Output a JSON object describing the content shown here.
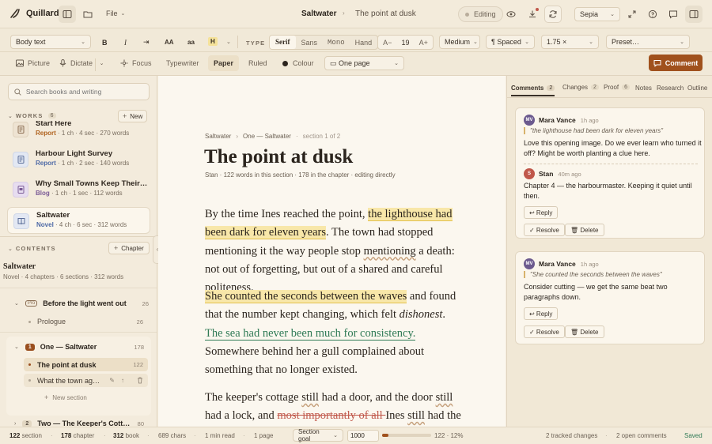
{
  "app": {
    "name": "Quillard",
    "file_menu": "File",
    "doc_title": "Saltwater",
    "section_title": "The point at dusk",
    "mode": "Editing",
    "theme": "Sepia"
  },
  "toolbar": {
    "style": "Body text",
    "bold": "B",
    "italic": "I",
    "indent": "⇥",
    "caps": "AA",
    "lower": "aa",
    "highlight": "H",
    "type_label": "TYPE",
    "fonts": [
      "Serif",
      "Sans",
      "Mono",
      "Hand"
    ],
    "size_dec": "A−",
    "size": "19",
    "size_inc": "A+",
    "weight": "Medium",
    "spacing": "¶ Spaced",
    "line_height": "1.75 ×",
    "preset": "Preset…"
  },
  "toolbar2": {
    "picture": "Picture",
    "dictate": "Dictate",
    "focus": "Focus",
    "typewriter": "Typewriter",
    "paper": "Paper",
    "ruled": "Ruled",
    "colour": "Colour",
    "view": "▭ One page",
    "comment": "Comment"
  },
  "sidebar": {
    "search_placeholder": "Search books and writing",
    "works_label": "WORKS",
    "works_count": "6",
    "new_label": "New",
    "works": [
      {
        "title": "Start Here",
        "kind": "Report",
        "meta": " · 1 ch · 4 sec · 270 words"
      },
      {
        "title": "Harbour Light Survey",
        "kind": "Report",
        "meta": " · 1 ch · 2 sec · 140 words"
      },
      {
        "title": "Why Small Towns Keep Their…",
        "kind": "Blog",
        "meta": " · 1 ch · 1 sec · 112 words"
      },
      {
        "title": "Saltwater",
        "kind": "Novel",
        "meta": " · 4 ch · 6 sec · 312 words"
      }
    ],
    "contents_label": "CONTENTS",
    "chapter_btn": "Chapter",
    "book_title": "Saltwater",
    "book_meta": "Novel · 4 chapters · 6 sections · 312 words",
    "chapters": [
      {
        "badge": "Pro",
        "title": "Before the light went out",
        "count": "26"
      },
      {
        "badge": "1",
        "title": "One — Saltwater",
        "count": "178"
      },
      {
        "badge": "2",
        "title": "Two — The Keeper's Cott…",
        "count": "80"
      }
    ],
    "sections": [
      {
        "title": "Prologue",
        "count": "26"
      },
      {
        "title": "The point at dusk",
        "count": "122"
      },
      {
        "title": "What the town ag…",
        "count": ""
      }
    ],
    "new_section": "New section"
  },
  "doc": {
    "crumb1": "Saltwater",
    "crumb2": "One — Saltwater",
    "crumb3": "section 1 of 2",
    "heading": "The point at dusk",
    "meta": "Stan · 122 words in this section · 178 in the chapter · editing directly",
    "p1a": "By the time Ines reached the point, ",
    "p1hl": "the lighthouse had been dark for eleven years",
    "p1b": ". The town had stopped mentioning it the way people stop ",
    "p1sq": "mentioning",
    "p1c": " a death: not out of forgetting, but out of a shared and careful politeness.",
    "p2hl": "She counted the seconds between the waves",
    "p2a": " and found that the number kept changing, which felt ",
    "p2em": "dishonest",
    "p2b": ". ",
    "p2ins": "The sea had never been much for consistency.",
    "p2c": " Somewhere behind her a gull complained about something that no longer existed.",
    "p3a": "The keeper's cottage ",
    "p3sq1": "still",
    "p3b": " had a door, and the door ",
    "p3sq2": "still",
    "p3c": " had a lock, and ",
    "p3del": "most importantly of all ",
    "p3d": "Ines ",
    "p3sq3": "still",
    "p3e": " had the key"
  },
  "panel": {
    "tabs": [
      {
        "label": "Comments",
        "badge": "2"
      },
      {
        "label": "Changes",
        "badge": "2"
      },
      {
        "label": "Proof",
        "badge": "6"
      },
      {
        "label": "Notes",
        "badge": ""
      },
      {
        "label": "Research",
        "badge": ""
      },
      {
        "label": "Outline",
        "badge": ""
      }
    ],
    "comments": [
      {
        "initials": "MV",
        "author": "Mara Vance",
        "time": "1h ago",
        "quote": "\"the lighthouse had been dark for eleven years\"",
        "text": "Love this opening image. Do we ever learn who turned it off? Might be worth planting a clue here.",
        "reply": {
          "initials": "S",
          "author": "Stan",
          "time": "40m ago",
          "text": "Chapter 4 — the harbourmaster. Keeping it quiet until then."
        }
      },
      {
        "initials": "MV",
        "author": "Mara Vance",
        "time": "1h ago",
        "quote": "\"She counted the seconds between the waves\"",
        "text": "Consider cutting — we get the same beat two paragraphs down."
      }
    ],
    "reply_label": "↩ Reply",
    "resolve_label": "✓ Resolve",
    "delete_label": "🗑 Delete"
  },
  "status": {
    "section_words": "122",
    "section_label": "section",
    "chapter_words": "178",
    "chapter_label": "chapter",
    "book_words": "312",
    "book_label": "book",
    "chars": "689 chars",
    "read": "1 min read",
    "pages": "1 page",
    "goal_label": "Section goal",
    "goal_value": "1000",
    "goal_progress": "122 · 12%",
    "goal_fraction": 0.122,
    "changes": "2 tracked changes",
    "comments": "2 open comments",
    "saved": "Saved"
  },
  "colors": {
    "accent": "#a0511d",
    "highlight": "#f8e7a9",
    "insert": "#2f7a55",
    "delete": "#c0574a",
    "saved": "#2f7a55"
  }
}
